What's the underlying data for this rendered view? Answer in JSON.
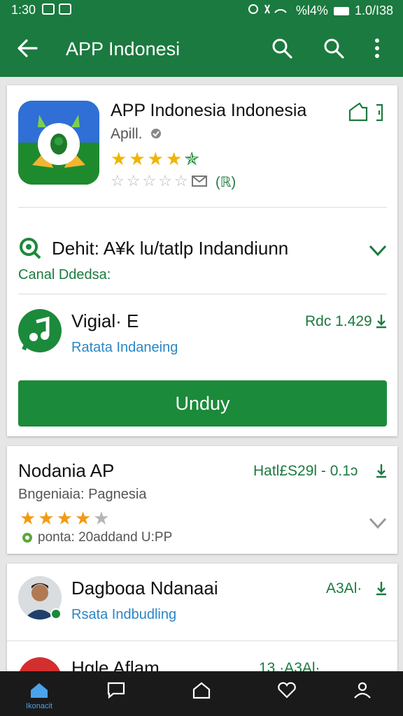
{
  "status_bar": {
    "time": "1:30",
    "right_text": "%l4% ",
    "right_time": "1.0/I38"
  },
  "toolbar": {
    "title": "APP Indonesi"
  },
  "app": {
    "name": "APP Indonesia Indonesia",
    "subtitle": "Apill.",
    "rating_stars": 5,
    "rating_count": "(ℝ)"
  },
  "section": {
    "title": "Dehit: A¥k lu/tatlp Indandiunn",
    "subtitle": "Canal Ddedsa:"
  },
  "item1": {
    "title": "Vigial· E",
    "link": "Ratata Indaneing",
    "price": "Rdc 1.429"
  },
  "install_button": {
    "label": "Unduy"
  },
  "card2": {
    "title": "Nodania AP",
    "price": "Hatl£S29l - 0.1ɔ",
    "subtitle": "Bngeniaia: Pagnesia",
    "rating": 4,
    "meta": "ponta: 20addand U:PP"
  },
  "card3": {
    "title": "Dagboɑa Ndanaai",
    "link": "Rsata Indbudling",
    "price": "A3Al·"
  },
  "card4": {
    "title": "Hgle Aflam",
    "price": "13.·A3Al·"
  },
  "nav": {
    "home_label": "Ikonacit"
  },
  "colors": {
    "primary": "#1b7a3f",
    "button": "#1b8a3a",
    "link": "#2a86c6",
    "star": "#f1b400"
  }
}
